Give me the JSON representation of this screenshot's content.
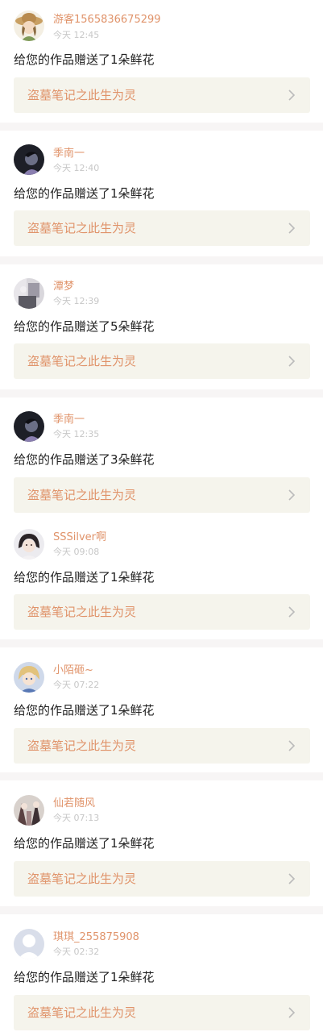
{
  "feed": {
    "items": [
      {
        "username": "游客1565836675299",
        "time": "今天 12:45",
        "message": "给您的作品赠送了1朵鲜花",
        "work_title": "盗墓笔记之此生为灵",
        "avatar_icon": "avatar-straw-hat-girl"
      },
      {
        "username": "季南一",
        "time": "今天 12:40",
        "message": "给您的作品赠送了1朵鲜花",
        "work_title": "盗墓笔记之此生为灵",
        "avatar_icon": "avatar-dark-portrait"
      },
      {
        "username": "潭梦",
        "time": "今天 12:39",
        "message": "给您的作品赠送了5朵鲜花",
        "work_title": "盗墓笔记之此生为灵",
        "avatar_icon": "avatar-photo"
      },
      {
        "username": "季南一",
        "time": "今天 12:35",
        "message": "给您的作品赠送了3朵鲜花",
        "work_title": "盗墓笔记之此生为灵",
        "avatar_icon": "avatar-dark-portrait"
      },
      {
        "username": "SSSilver啊",
        "time": "今天 09:08",
        "message": "给您的作品赠送了1朵鲜花",
        "work_title": "盗墓笔记之此生为灵",
        "avatar_icon": "avatar-dark-hair-girl"
      },
      {
        "username": "小陌砸~",
        "time": "今天 07:22",
        "message": "给您的作品赠送了1朵鲜花",
        "work_title": "盗墓笔记之此生为灵",
        "avatar_icon": "avatar-blonde-boy"
      },
      {
        "username": "仙若随风",
        "time": "今天 07:13",
        "message": "给您的作品赠送了1朵鲜花",
        "work_title": "盗墓笔记之此生为灵",
        "avatar_icon": "avatar-anime-figure"
      },
      {
        "username": "琪琪_255875908",
        "time": "今天 02:32",
        "message": "给您的作品赠送了1朵鲜花",
        "work_title": "盗墓笔记之此生为灵",
        "avatar_icon": "avatar-default-user"
      }
    ]
  },
  "colors": {
    "accent": "#e0936a",
    "card_bg": "#f5f4ec",
    "separator": "#f7f5f5",
    "time": "#c7c7c7",
    "text": "#222222",
    "chevron": "#bbbbbb"
  }
}
